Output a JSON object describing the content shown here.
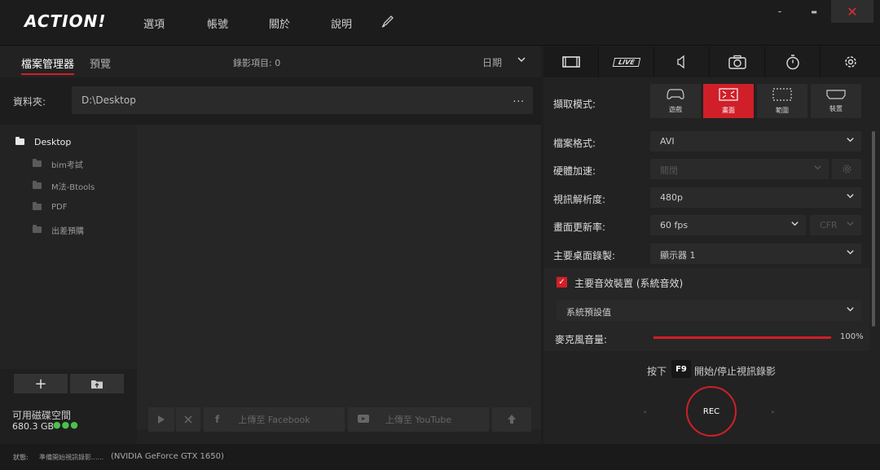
{
  "app": {
    "logo": "ACTION!",
    "menu": [
      "選項",
      "帳號",
      "關於",
      "說明"
    ],
    "window": {
      "minimize": "-",
      "maximize": "▬",
      "close": "✕"
    }
  },
  "left": {
    "tabs": {
      "file_manager": "檔案管理器",
      "preview": "預覽"
    },
    "record_count": "錄影項目: 0",
    "sort": "日期",
    "folder_label": "資料夾:",
    "folder_path": "D:\\Desktop",
    "folder_more": "...",
    "tree": {
      "root": "Desktop",
      "children": [
        "bim考試",
        "M法-Btools",
        "PDF",
        "出差預購"
      ]
    },
    "add_button": "+",
    "disk": {
      "label": "可用磁碟空間",
      "value": "680.3 GB"
    },
    "upload_facebook": "上傳至 Facebook",
    "upload_youtube": "上傳至 YouTube"
  },
  "right": {
    "tabs": {
      "live": "LIVE"
    },
    "capture": {
      "label": "擷取模式:",
      "modes": [
        "遊戲",
        "畫面",
        "範圍",
        "裝置"
      ]
    },
    "settings": {
      "format": {
        "label": "檔案格式:",
        "value": "AVI"
      },
      "hw_accel": {
        "label": "硬體加速:",
        "value": "關閉"
      },
      "resolution": {
        "label": "視訊解析度:",
        "value": "480p"
      },
      "fps": {
        "label": "畫面更新率:",
        "value": "60 fps",
        "secondary": "CFR"
      },
      "desktop": {
        "label": "主要桌面錄製:",
        "value": "顯示器 1"
      }
    },
    "audio": {
      "device_label": "主要音效裝置 (系統音效)",
      "device_value": "系統預設值",
      "mic_label": "麥克風音量:",
      "mic_value": "100%",
      "mic_level": 1.0
    },
    "hotkey": {
      "pre": "按下",
      "key": "F9",
      "post": "開始/停止視訊錄影"
    },
    "rec": "REC"
  },
  "status": {
    "label": "狀態:",
    "text": "準備開始視訊錄影......",
    "gpu": "(NVIDIA GeForce GTX 1650)"
  },
  "colors": {
    "accent": "#d01f28",
    "background": "#1e1e1e",
    "ok": "#4cc04c"
  }
}
